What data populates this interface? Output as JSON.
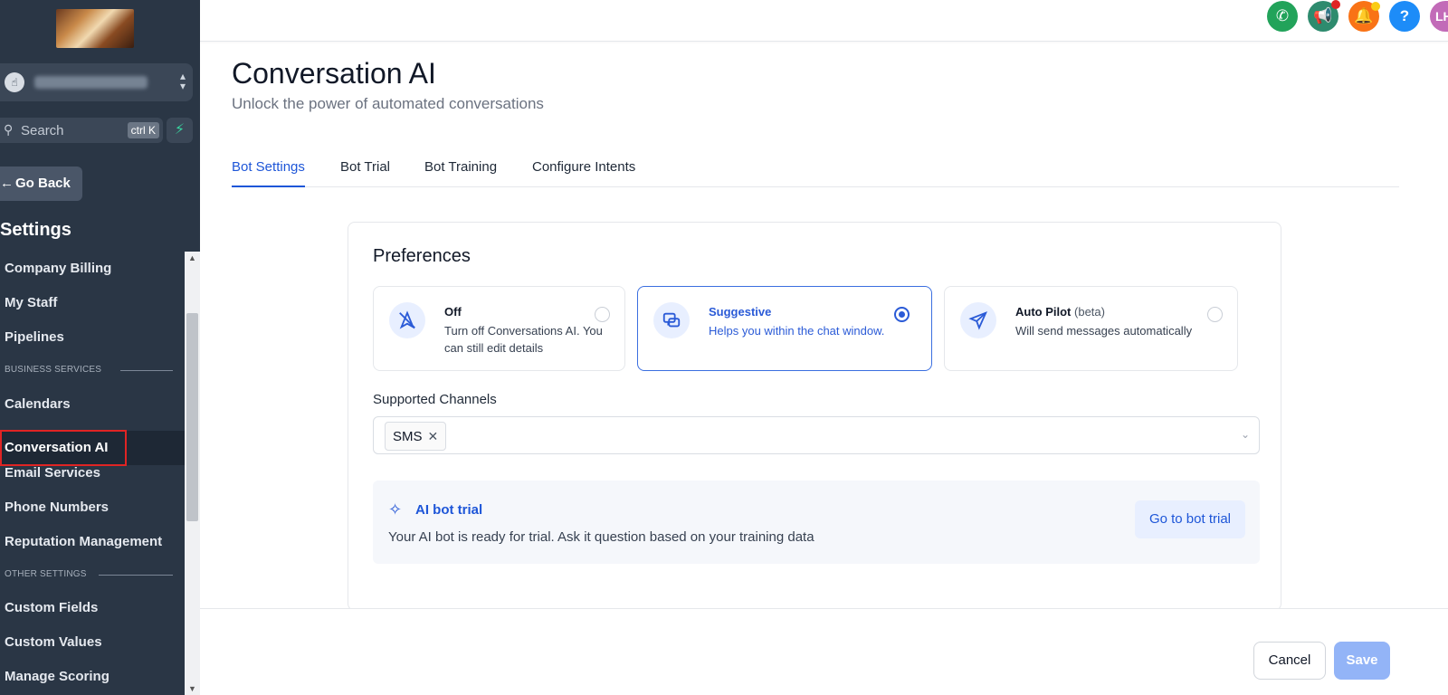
{
  "sidebar": {
    "account_chevron": "⌃⌄",
    "search": {
      "placeholder": "Search",
      "shortcut": "ctrl K"
    },
    "go_back": "Go Back",
    "settings_title": "Settings",
    "items": [
      {
        "label": "Company Billing"
      },
      {
        "label": "My Staff"
      },
      {
        "label": "Pipelines"
      },
      {
        "label": "Calendars"
      },
      {
        "label": "Conversation AI"
      },
      {
        "label": "Email Services"
      },
      {
        "label": "Phone Numbers"
      },
      {
        "label": "Reputation Management"
      },
      {
        "label": "Custom Fields"
      },
      {
        "label": "Custom Values"
      },
      {
        "label": "Manage Scoring"
      }
    ],
    "sections": [
      "BUSINESS SERVICES",
      "OTHER SETTINGS"
    ],
    "active_item": "Conversation AI"
  },
  "topbar": {
    "icons": [
      "phone-icon",
      "megaphone-icon",
      "bell-icon",
      "help-icon"
    ],
    "avatar_initials": "LH",
    "colors": {
      "phone": "#22a35a",
      "megaphone": "#2e8b6e",
      "bell": "#f97316",
      "help": "#1d8cf8",
      "avatar": "#c26bb8"
    }
  },
  "page": {
    "title": "Conversation AI",
    "subtitle": "Unlock the power of automated conversations"
  },
  "tabs": [
    {
      "label": "Bot Settings",
      "active": true
    },
    {
      "label": "Bot Trial",
      "active": false
    },
    {
      "label": "Bot Training",
      "active": false
    },
    {
      "label": "Configure Intents",
      "active": false
    }
  ],
  "preferences": {
    "title": "Preferences",
    "options": [
      {
        "title": "Off",
        "desc": "Turn off Conversations AI. You can still edit details",
        "selected": false
      },
      {
        "title": "Suggestive",
        "desc": "Helps you within the chat window.",
        "selected": true
      },
      {
        "title": "Auto Pilot",
        "badge": "(beta)",
        "desc": "Will send messages automatically",
        "selected": false
      }
    ]
  },
  "channels": {
    "label": "Supported Channels",
    "selected": [
      "SMS"
    ]
  },
  "trial": {
    "title": "AI bot trial",
    "desc": "Your AI bot is ready for trial. Ask it question based on your training data",
    "button": "Go to bot trial"
  },
  "footer": {
    "cancel": "Cancel",
    "save": "Save"
  },
  "colors": {
    "accent": "#1e56d8",
    "sidebar_bg": "#2a3645",
    "save_disabled": "#93b4f7"
  }
}
